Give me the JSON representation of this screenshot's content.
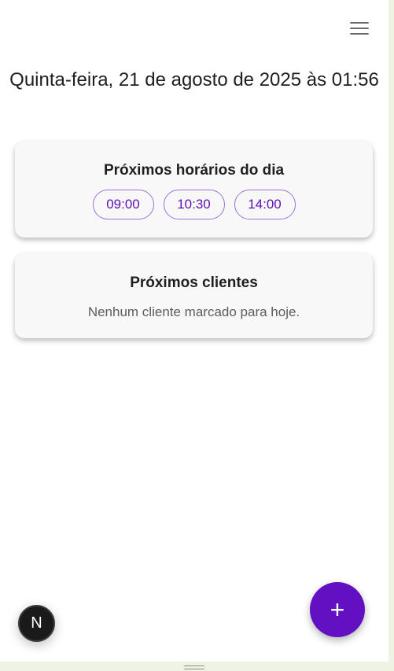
{
  "header": {
    "menu_icon": "hamburger-menu-icon",
    "date_title": "Quinta-feira, 21 de agosto de 2025 às 01:56"
  },
  "next_times_card": {
    "title": "Próximos horários do dia",
    "times": [
      "09:00",
      "10:30",
      "14:00"
    ]
  },
  "next_clients_card": {
    "title": "Próximos clientes",
    "empty_message": "Nenhum cliente marcado para hoje."
  },
  "fab": {
    "icon": "plus-icon",
    "label": "+"
  },
  "dev_badge": {
    "icon": "nextjs-logo-icon",
    "label": "N"
  },
  "colors": {
    "accent": "#6210c2",
    "chip_text": "#5f0fb6",
    "chip_border": "#9d73d8",
    "card_bg": "#f8f8f8"
  }
}
